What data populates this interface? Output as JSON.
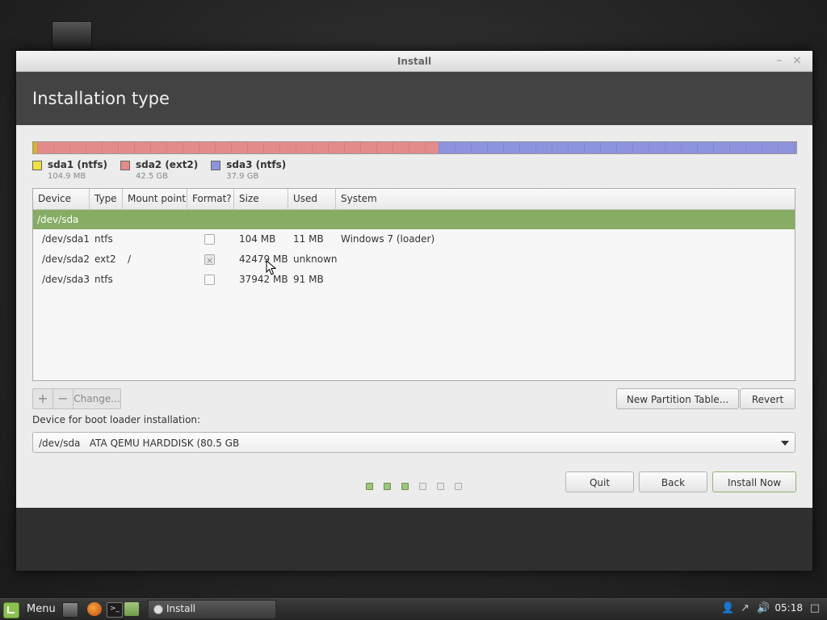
{
  "window": {
    "title": "Install",
    "minimize_glyph": "–",
    "close_glyph": "×"
  },
  "header": {
    "title": "Installation type"
  },
  "partition_bar": [
    {
      "name": "sda1",
      "color": "#d9b72a",
      "size_mb": 104.9
    },
    {
      "name": "sda2",
      "color": "#e38b8b",
      "size_mb": 42500
    },
    {
      "name": "sda3",
      "color": "#8e93dd",
      "size_mb": 37900
    }
  ],
  "legend": [
    {
      "label": "sda1 (ntfs)",
      "size": "104.9 MB",
      "color": "#f0e040"
    },
    {
      "label": "sda2 (ext2)",
      "size": "42.5 GB",
      "color": "#e38b8b"
    },
    {
      "label": "sda3 (ntfs)",
      "size": "37.9 GB",
      "color": "#8e93dd"
    }
  ],
  "table": {
    "columns": [
      "Device",
      "Type",
      "Mount point",
      "Format?",
      "Size",
      "Used",
      "System"
    ],
    "disk": "/dev/sda",
    "rows": [
      {
        "device": "/dev/sda1",
        "type": "ntfs",
        "mount": "",
        "format": false,
        "size": "104 MB",
        "used": "11 MB",
        "system": "Windows 7 (loader)"
      },
      {
        "device": "/dev/sda2",
        "type": "ext2",
        "mount": "/",
        "format": true,
        "size": "42479 MB",
        "used": "unknown",
        "system": ""
      },
      {
        "device": "/dev/sda3",
        "type": "ntfs",
        "mount": "",
        "format": false,
        "size": "37942 MB",
        "used": "91 MB",
        "system": ""
      }
    ]
  },
  "toolbar": {
    "add": "+",
    "remove": "−",
    "change": "Change..."
  },
  "buttons": {
    "new_partition_table": "New Partition Table...",
    "revert": "Revert",
    "quit": "Quit",
    "back": "Back",
    "install_now": "Install Now"
  },
  "bootloader": {
    "label": "Device for boot loader installation:",
    "device": "/dev/sda",
    "description": "ATA QEMU HARDDISK (80.5 GB"
  },
  "progress_steps": {
    "total": 6,
    "completed": 3
  },
  "taskbar": {
    "menu_label": "Menu",
    "task_label": "Install",
    "clock": "05:18",
    "terminal_glyph": ">_"
  },
  "icons": [
    "mint-menu-icon",
    "show-desktop-icon",
    "firefox-icon",
    "terminal-icon",
    "files-icon",
    "installer-icon",
    "user-icon",
    "network-icon",
    "volume-icon",
    "display-icon"
  ]
}
